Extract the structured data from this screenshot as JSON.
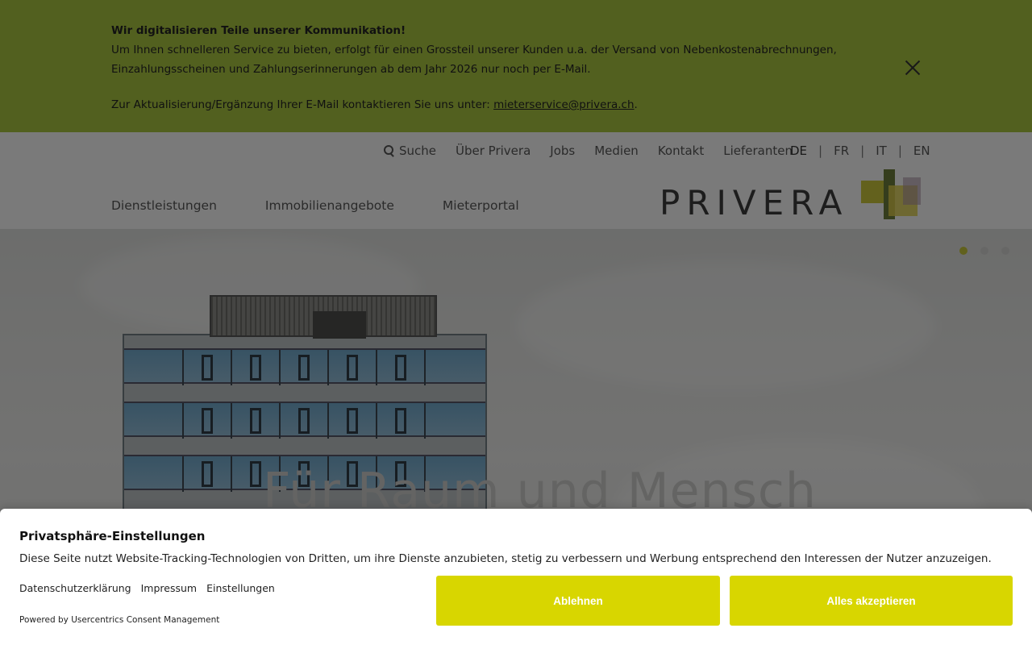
{
  "notice": {
    "title": "Wir digitalisieren Teile unserer Kommunikation!",
    "text": "Um Ihnen schnelleren Service zu bieten, erfolgt für einen Grossteil unserer Kunden u.a. der Versand von Nebenkostenabrechnungen, Einzahlungsscheinen und Zahlungserinnerungen ab dem Jahr 2026 nur noch per E-Mail.",
    "contact_prefix": "Zur Aktualisierung/Ergänzung Ihrer E-Mail kontaktieren Sie uns unter: ",
    "contact_email": "mieterservice@privera.ch",
    "contact_suffix": "."
  },
  "header": {
    "topnav": [
      "Suche",
      "Über Privera",
      "Jobs",
      "Medien",
      "Kontakt",
      "Lieferanten"
    ],
    "languages": [
      "DE",
      "FR",
      "IT",
      "EN"
    ],
    "active_language": "DE",
    "mainnav": [
      "Dienstleistungen",
      "Immobilienangebote",
      "Mieterportal"
    ],
    "logo_text": "PRIVERA"
  },
  "hero": {
    "title": "Für Raum und Mensch",
    "slide_count": 3,
    "active_slide": 1
  },
  "consent": {
    "title": "Privatsphäre-Einstellungen",
    "description": "Diese Seite nutzt Website-Tracking-Technologien von Dritten, um ihre Dienste anzubieten, stetig zu verbessern und Werbung entsprechend den Interessen der Nutzer anzuzeigen.",
    "links": [
      "Datenschutzerklärung",
      "Impressum",
      "Einstellungen"
    ],
    "powered_by": "Powered by Usercentrics Consent Management",
    "decline_label": "Ablehnen",
    "accept_label": "Alles akzeptieren"
  },
  "colors": {
    "notice_bg": "#a4c13f",
    "button_bg": "#d8d600",
    "active_dot": "#c2c23a"
  }
}
